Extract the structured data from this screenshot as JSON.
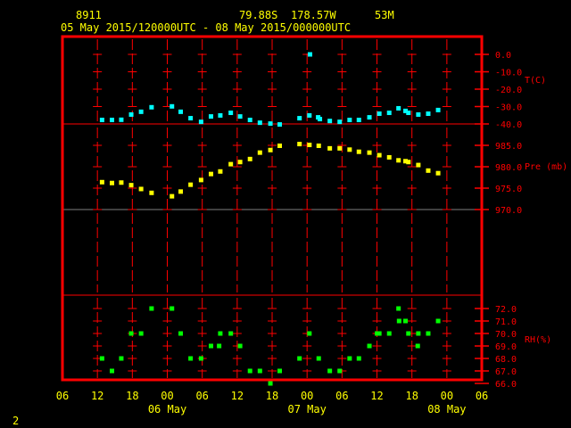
{
  "header": {
    "station": "8911",
    "lat": "79.88S",
    "lon": "178.57W",
    "elev": "53M",
    "period": "05 May 2015/120000UTC - 08 May 2015/000000UTC"
  },
  "page_number": "2",
  "colors": {
    "frame": "#ff0000",
    "temp": "#00ffff",
    "pressure": "#ffff00",
    "rh": "#00ff00",
    "text": "#ffff00",
    "axis_text": "#ff0000"
  },
  "chart_data": [
    {
      "type": "scatter",
      "title": "Temperature",
      "ylabel": "T(C)",
      "ylim": [
        -40,
        0
      ],
      "yticks": [
        "0.0",
        "-10.0",
        "-20.0",
        "-30.0",
        "-40.0"
      ],
      "ytick_values": [
        0,
        -10,
        -20,
        -30,
        -40
      ],
      "x_units": "hours since 05 May 06 UTC",
      "points": [
        [
          6.8,
          -37.7
        ],
        [
          8.5,
          -37.7
        ],
        [
          10.1,
          -37.6
        ],
        [
          11.8,
          -34.6
        ],
        [
          13.5,
          -33.0
        ],
        [
          15.3,
          -30.4
        ],
        [
          18.8,
          -29.9
        ],
        [
          20.3,
          -33.0
        ],
        [
          22.0,
          -36.7
        ],
        [
          23.8,
          -38.8
        ],
        [
          25.5,
          -35.7
        ],
        [
          27.1,
          -35.1
        ],
        [
          28.9,
          -33.6
        ],
        [
          30.5,
          -35.7
        ],
        [
          32.2,
          -37.7
        ],
        [
          33.9,
          -39.3
        ],
        [
          35.7,
          -39.8
        ],
        [
          37.3,
          -40.3
        ],
        [
          40.7,
          -36.7
        ],
        [
          42.4,
          -35.1
        ],
        [
          42.5,
          0.0
        ],
        [
          43.9,
          -36.2
        ],
        [
          44.2,
          -37.2
        ],
        [
          45.9,
          -38.3
        ],
        [
          47.6,
          -38.8
        ],
        [
          49.3,
          -37.7
        ],
        [
          50.9,
          -37.7
        ],
        [
          52.7,
          -36.2
        ],
        [
          54.4,
          -34.1
        ],
        [
          56.1,
          -33.6
        ],
        [
          57.7,
          -31.0
        ],
        [
          58.9,
          -32.5
        ],
        [
          59.4,
          -33.6
        ],
        [
          61.1,
          -34.6
        ],
        [
          62.8,
          -34.1
        ],
        [
          64.5,
          -32.0
        ]
      ]
    },
    {
      "type": "scatter",
      "title": "Pressure",
      "ylabel": "Pre (mb)",
      "ylim": [
        970,
        985
      ],
      "yticks": [
        "985.0",
        "980.0",
        "975.0",
        "970.0"
      ],
      "ytick_values": [
        985,
        980,
        975,
        970
      ],
      "x_units": "hours since 05 May 06 UTC",
      "points": [
        [
          6.8,
          976.4
        ],
        [
          8.5,
          976.2
        ],
        [
          10.1,
          976.3
        ],
        [
          11.8,
          975.7
        ],
        [
          13.5,
          974.8
        ],
        [
          15.3,
          973.9
        ],
        [
          18.8,
          973.1
        ],
        [
          20.3,
          974.2
        ],
        [
          22.0,
          975.8
        ],
        [
          23.8,
          976.9
        ],
        [
          25.5,
          978.3
        ],
        [
          27.1,
          978.9
        ],
        [
          28.9,
          980.6
        ],
        [
          30.5,
          981.1
        ],
        [
          32.2,
          981.8
        ],
        [
          33.9,
          983.3
        ],
        [
          35.7,
          983.9
        ],
        [
          37.3,
          984.9
        ],
        [
          40.7,
          985.3
        ],
        [
          42.4,
          985.1
        ],
        [
          44.0,
          984.9
        ],
        [
          45.9,
          984.3
        ],
        [
          47.6,
          984.3
        ],
        [
          49.3,
          984.0
        ],
        [
          50.9,
          983.5
        ],
        [
          52.7,
          983.3
        ],
        [
          54.4,
          982.7
        ],
        [
          56.1,
          982.2
        ],
        [
          57.7,
          981.5
        ],
        [
          58.9,
          981.3
        ],
        [
          59.4,
          981.1
        ],
        [
          61.1,
          980.4
        ],
        [
          62.8,
          979.1
        ],
        [
          64.5,
          978.5
        ]
      ]
    },
    {
      "type": "scatter",
      "title": "Relative Humidity",
      "ylabel": "RH(%)",
      "ylim": [
        66,
        72
      ],
      "yticks": [
        "72.0",
        "71.0",
        "70.0",
        "69.0",
        "68.0",
        "67.0",
        "66.0"
      ],
      "ytick_values": [
        72,
        71,
        70,
        69,
        68,
        67,
        66
      ],
      "x_units": "hours since 05 May 06 UTC",
      "points": [
        [
          6.8,
          68
        ],
        [
          8.5,
          67
        ],
        [
          10.1,
          68
        ],
        [
          11.8,
          70
        ],
        [
          13.5,
          70
        ],
        [
          15.3,
          72
        ],
        [
          18.8,
          72
        ],
        [
          20.3,
          70
        ],
        [
          22.0,
          68
        ],
        [
          23.8,
          68
        ],
        [
          25.5,
          69
        ],
        [
          26.9,
          69
        ],
        [
          27.1,
          70
        ],
        [
          28.9,
          70
        ],
        [
          30.5,
          69
        ],
        [
          32.2,
          67
        ],
        [
          33.9,
          67
        ],
        [
          35.7,
          66
        ],
        [
          37.3,
          67
        ],
        [
          40.7,
          68
        ],
        [
          42.4,
          70
        ],
        [
          44.0,
          68
        ],
        [
          45.9,
          67
        ],
        [
          47.6,
          67
        ],
        [
          49.3,
          68
        ],
        [
          50.9,
          68
        ],
        [
          52.7,
          69
        ],
        [
          54.0,
          70
        ],
        [
          54.4,
          70
        ],
        [
          56.1,
          70
        ],
        [
          57.7,
          72
        ],
        [
          57.8,
          71
        ],
        [
          58.9,
          71
        ],
        [
          59.4,
          70
        ],
        [
          61.0,
          69
        ],
        [
          61.1,
          70
        ],
        [
          62.8,
          70
        ],
        [
          64.5,
          71
        ]
      ]
    }
  ],
  "x_axis": {
    "xlim_hours": [
      0,
      72
    ],
    "tick_labels": [
      "06",
      "12",
      "18",
      "00",
      "06",
      "12",
      "18",
      "00",
      "06",
      "12",
      "18",
      "00",
      "06"
    ],
    "date_labels": [
      {
        "text": "06 May",
        "hour": 18
      },
      {
        "text": "07 May",
        "hour": 42
      },
      {
        "text": "08 May",
        "hour": 66
      }
    ]
  }
}
